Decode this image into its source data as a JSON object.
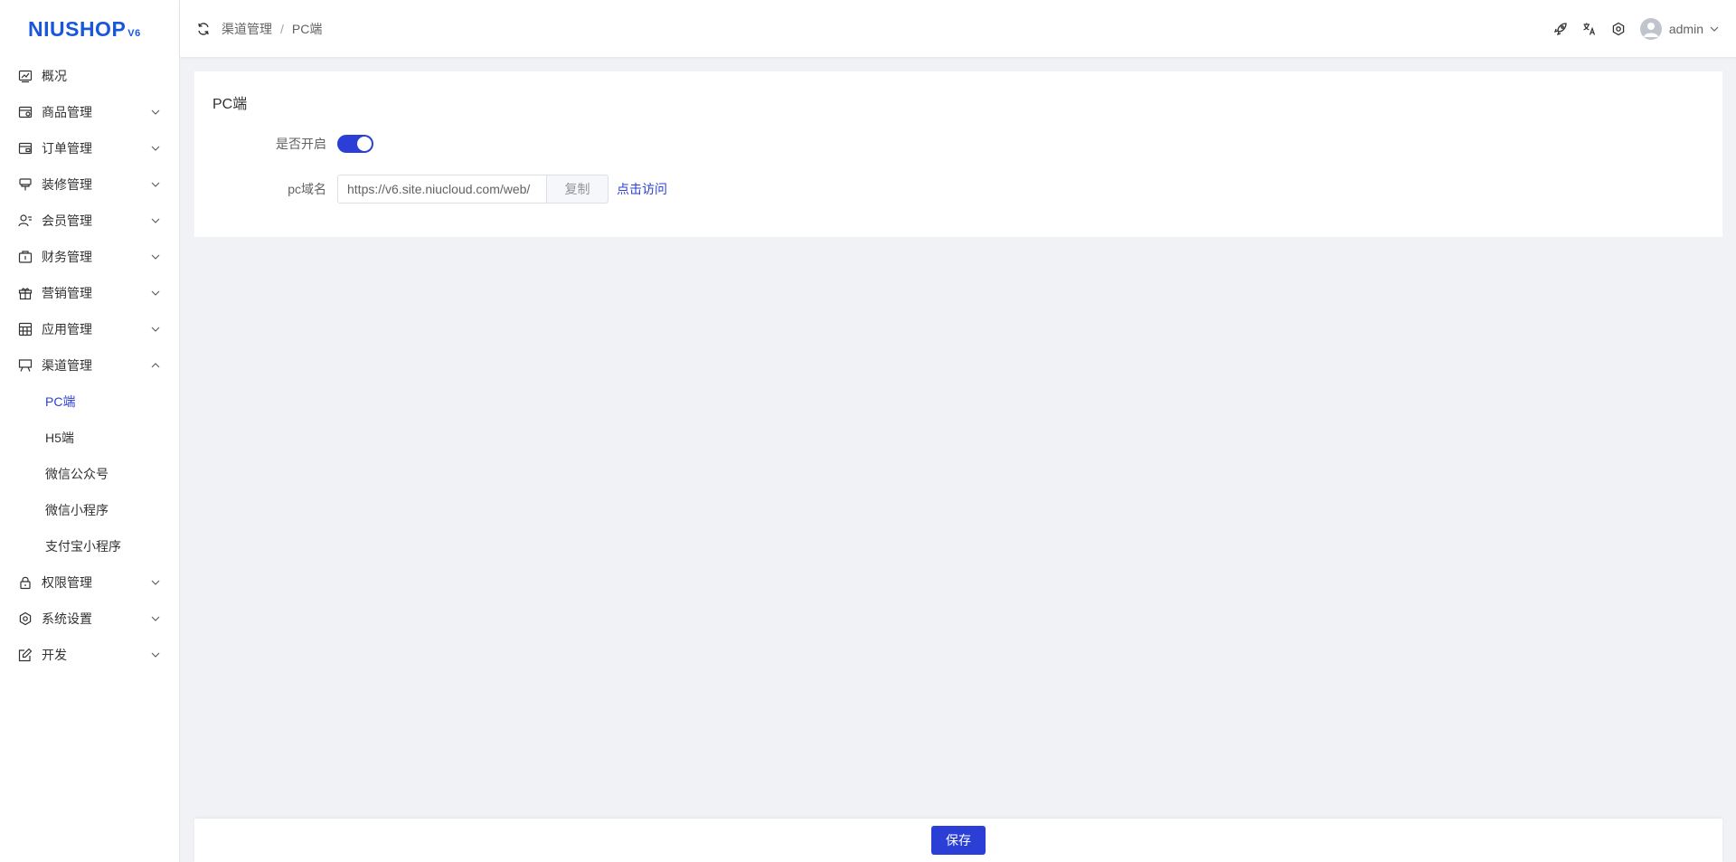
{
  "logo": {
    "text": "NIUSHOP",
    "version": "V6"
  },
  "sidebar": {
    "items": [
      {
        "label": "概况",
        "icon": "line-chart-icon"
      },
      {
        "label": "商品管理",
        "icon": "goods-icon"
      },
      {
        "label": "订单管理",
        "icon": "order-icon"
      },
      {
        "label": "装修管理",
        "icon": "decorate-icon"
      },
      {
        "label": "会员管理",
        "icon": "member-icon"
      },
      {
        "label": "财务管理",
        "icon": "finance-icon"
      },
      {
        "label": "营销管理",
        "icon": "gift-icon"
      },
      {
        "label": "应用管理",
        "icon": "app-grid-icon"
      },
      {
        "label": "渠道管理",
        "icon": "channel-icon"
      },
      {
        "label": "权限管理",
        "icon": "lock-icon"
      },
      {
        "label": "系统设置",
        "icon": "gear-icon"
      },
      {
        "label": "开发",
        "icon": "edit-icon"
      }
    ],
    "channel_sub": [
      "PC端",
      "H5端",
      "微信公众号",
      "微信小程序",
      "支付宝小程序"
    ]
  },
  "header": {
    "breadcrumb": [
      "渠道管理",
      "PC端"
    ],
    "breadcrumb_sep": "/",
    "username": "admin"
  },
  "card": {
    "title": "PC端",
    "enable_label": "是否开启",
    "enable_value": true,
    "domain_label": "pc域名",
    "domain_value": "https://v6.site.niucloud.com/web/",
    "copy_label": "复制",
    "visit_label": "点击访问"
  },
  "footer": {
    "save_label": "保存"
  },
  "colors": {
    "primary": "#2b3fd6",
    "logo": "#1a56db",
    "background": "#f0f2f5"
  }
}
